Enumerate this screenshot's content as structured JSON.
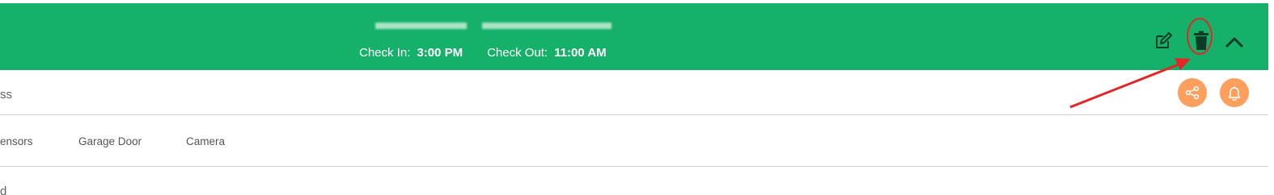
{
  "header": {
    "title_redacted": true,
    "check_in_label": "Check In:",
    "check_in_time": "3:00 PM",
    "check_out_label": "Check Out:",
    "check_out_time": "11:00 AM",
    "bg_color": "#15b06a",
    "icons": [
      "edit-icon",
      "trash-icon",
      "chevron-up-icon"
    ]
  },
  "subrow": {
    "label": "ss",
    "share_icon": "share-icon",
    "bell_icon": "bell-icon",
    "button_color": "#ff9f5e"
  },
  "tabs": [
    {
      "label": "ensors"
    },
    {
      "label": "Garage Door"
    },
    {
      "label": "Camera"
    }
  ],
  "bottom": {
    "label": "d"
  },
  "annotation": {
    "color": "#e32626",
    "target": "delete-button"
  }
}
